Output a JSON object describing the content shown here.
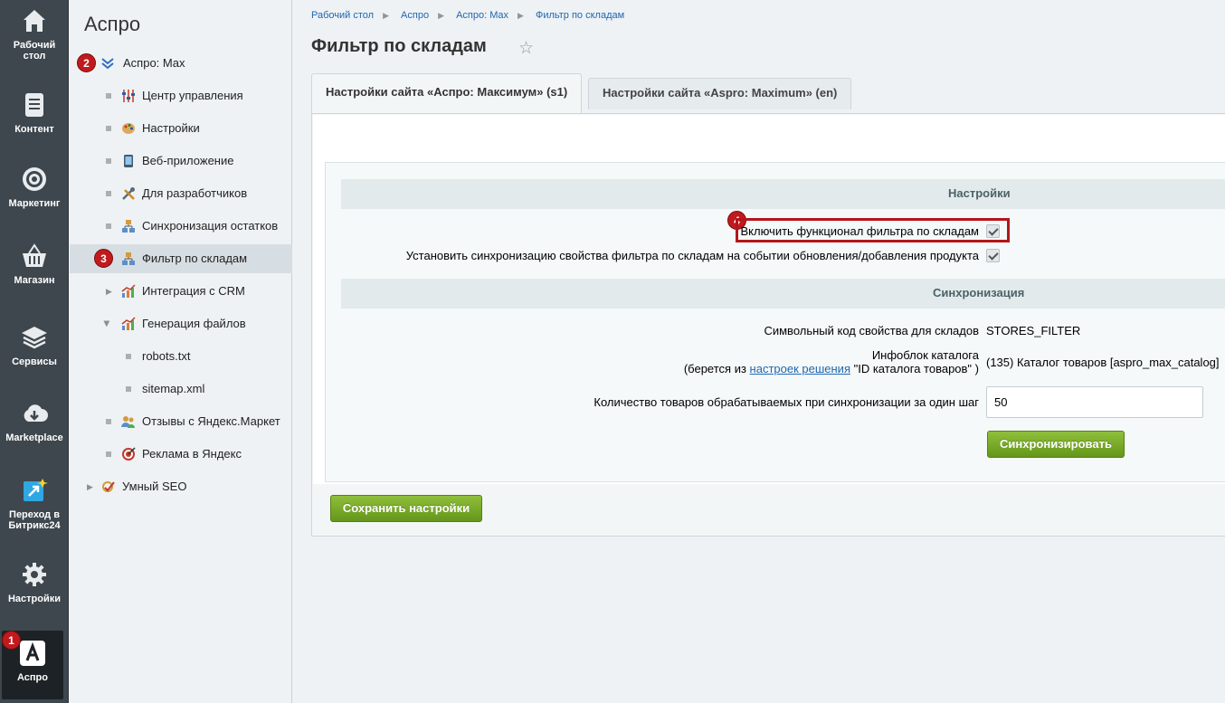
{
  "rail": {
    "items": [
      {
        "label_line1": "Рабочий",
        "label_line2": "стол"
      },
      {
        "label_line1": "Контент",
        "label_line2": ""
      },
      {
        "label_line1": "Маркетинг",
        "label_line2": ""
      },
      {
        "label_line1": "Магазин",
        "label_line2": ""
      },
      {
        "label_line1": "Сервисы",
        "label_line2": ""
      },
      {
        "label_line1": "Marketplace",
        "label_line2": ""
      },
      {
        "label_line1": "Переход в",
        "label_line2": "Битрикс24"
      },
      {
        "label_line1": "Настройки",
        "label_line2": ""
      },
      {
        "label_line1": "Аспро",
        "label_line2": ""
      }
    ],
    "badge": "1"
  },
  "menu": {
    "title": "Аспро",
    "root_label": "Аспро: Max",
    "root_badge": "2",
    "items": [
      {
        "label": "Центр управления"
      },
      {
        "label": "Настройки"
      },
      {
        "label": "Веб-приложение"
      },
      {
        "label": "Для разработчиков"
      },
      {
        "label": "Синхронизация остатков"
      },
      {
        "label": "Фильтр по складам"
      },
      {
        "label": "Интеграция с CRM"
      },
      {
        "label": "Генерация файлов"
      },
      {
        "label": "robots.txt"
      },
      {
        "label": "sitemap.xml"
      },
      {
        "label": "Отзывы с Яндекс.Маркет"
      },
      {
        "label": "Реклама в Яндекс"
      },
      {
        "label": "Умный SEO"
      }
    ],
    "selected_badge": "3"
  },
  "breadcrumbs": [
    "Рабочий стол",
    "Аспро",
    "Аспро: Max",
    "Фильтр по складам"
  ],
  "page_title": "Фильтр по складам",
  "tabs": [
    {
      "label": "Настройки сайта «Аспро: Максимум» (s1)"
    },
    {
      "label": "Настройки сайта «Aspro: Maximum» (en)"
    }
  ],
  "form": {
    "section_settings": "Настройки",
    "enable_label": "Включить функционал фильтра по складам",
    "enable_badge": "4",
    "enable_checked": true,
    "sync_prop_label": "Установить синхронизацию свойства фильтра по складам на событии обновления/добавления продукта",
    "sync_prop_checked": true,
    "section_sync": "Синхронизация",
    "code_label": "Символьный код свойства для складов",
    "code_value": "STORES_FILTER",
    "iblock_label_line1": "Инфоблок каталога",
    "iblock_label_prefix": "(берется из ",
    "iblock_label_link": "настроек решения",
    "iblock_label_suffix": " \"ID каталога товаров\" )",
    "iblock_value": "(135) Каталог товаров [aspro_max_catalog]",
    "count_label": "Количество товаров обрабатываемых при синхронизации за один шаг",
    "count_value": "50",
    "sync_button": "Синхронизировать",
    "save_button": "Сохранить настройки"
  }
}
